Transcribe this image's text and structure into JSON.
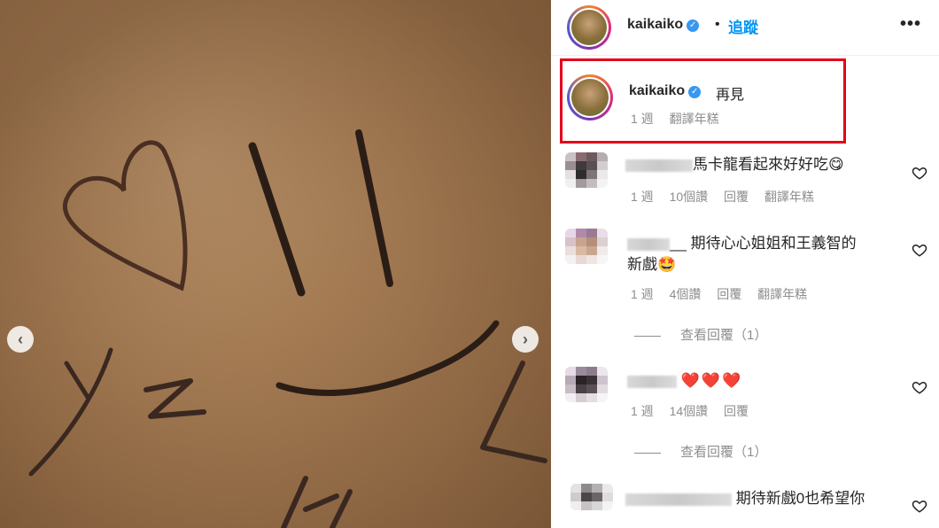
{
  "header": {
    "username": "kaikaiko",
    "separator": "•",
    "follow_label": "追蹤",
    "more_label": "•••"
  },
  "caption": {
    "username": "kaikaiko",
    "text": "再見",
    "time": "1 週",
    "translate": "翻譯年糕"
  },
  "comments": [
    {
      "text": "馬卡龍看起來好好吃😋",
      "time": "1 週",
      "likes": "10個讚",
      "reply": "回覆",
      "translate": "翻譯年糕"
    },
    {
      "prefix": "__",
      "text_line1": "期待心心姐姐和王義智的",
      "text_line2": "新戲🤩",
      "time": "1 週",
      "likes": "4個讚",
      "reply": "回覆",
      "translate": "翻譯年糕",
      "view_replies": "查看回覆（1）"
    },
    {
      "text": "❤️❤️❤️",
      "time": "1 週",
      "likes": "14個讚",
      "reply": "回覆",
      "view_replies": "查看回覆（1）"
    },
    {
      "text": "期待新戲0也希望你"
    }
  ],
  "colors": {
    "accent": "#0095f6",
    "verified": "#3897f0",
    "highlight": "#e3001b",
    "heart": "#e0151f"
  },
  "icons": {
    "prev": "chevron-left-icon",
    "next": "chevron-right-icon",
    "like": "heart-outline-icon",
    "verified": "verified-badge-icon"
  }
}
